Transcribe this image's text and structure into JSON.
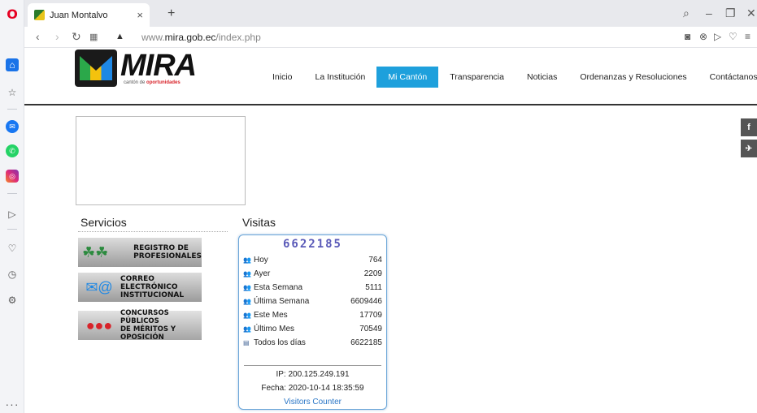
{
  "browser": {
    "tab_title": "Juan Montalvo",
    "tab_close": "×",
    "new_tab": "+",
    "url_prefix": "www.",
    "url_domain": "mira.gob.ec",
    "url_path": "/index.php"
  },
  "site": {
    "logo_word": "MIRA",
    "logo_sub_prefix": "cantón de ",
    "logo_sub_bold": "oportunidades",
    "menu": [
      {
        "label": "Inicio"
      },
      {
        "label": "La Institución"
      },
      {
        "label": "Mi Cantón",
        "active": true
      },
      {
        "label": "Transparencia"
      },
      {
        "label": "Noticias"
      },
      {
        "label": "Ordenanzas y Resoluciones"
      },
      {
        "label": "Contáctanos"
      }
    ],
    "social": {
      "facebook": "f",
      "twitter": "t"
    }
  },
  "servicios": {
    "title": "Servicios",
    "items": [
      {
        "line1": "REGISTRO DE",
        "line2": "PROFESIONALES",
        "icon": "people-icon"
      },
      {
        "line1": "CORREO ELECTRÓNICO",
        "line2": "INSTITUCIONAL",
        "icon": "email-icon"
      },
      {
        "line1": "CONCURSOS PÚBLICOS",
        "line2": "DE MÉRITOS Y OPOSICIÓN",
        "icon": "candidates-icon"
      }
    ]
  },
  "visitas": {
    "title": "Visitas",
    "counter": "6622185",
    "rows": [
      {
        "label": "Hoy",
        "value": "764"
      },
      {
        "label": "Ayer",
        "value": "2209"
      },
      {
        "label": "Esta Semana",
        "value": "5111"
      },
      {
        "label": "Última Semana",
        "value": "6609446"
      },
      {
        "label": "Este Mes",
        "value": "17709"
      },
      {
        "label": "Último Mes",
        "value": "70549"
      },
      {
        "label": "Todos los días",
        "value": "6622185"
      }
    ],
    "ip": "IP: 200.125.249.191",
    "fecha": "Fecha: 2020-10-14 18:35:59",
    "link": "Visitors Counter"
  }
}
